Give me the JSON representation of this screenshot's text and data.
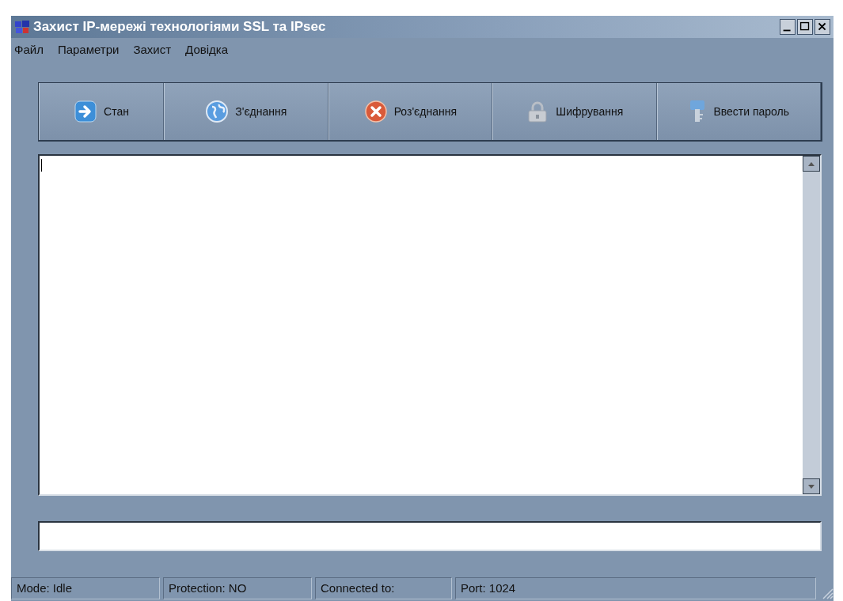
{
  "window": {
    "title": "Захист IP-мережі технологіями SSL та IPsec"
  },
  "menu": [
    "Файл",
    "Параметри",
    "Захист",
    "Довідка"
  ],
  "toolbar": [
    {
      "label": "Стан"
    },
    {
      "label": "З'єднання"
    },
    {
      "label": "Роз'єднання"
    },
    {
      "label": "Шифрування"
    },
    {
      "label": "Ввести пароль"
    }
  ],
  "status_bar": [
    "Mode: Idle",
    "Protection: NO",
    "Connected to:",
    "Port: 1024"
  ]
}
